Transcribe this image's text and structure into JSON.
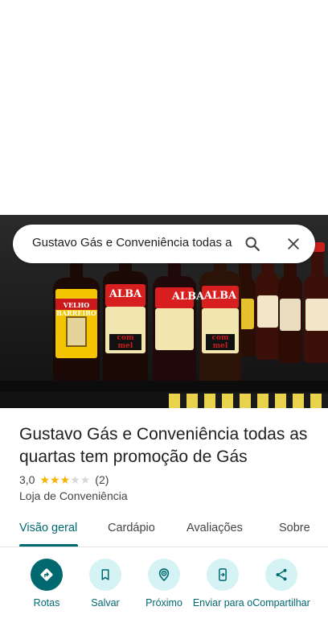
{
  "search": {
    "query": "Gustavo Gás e Conveniência todas a"
  },
  "place": {
    "name": "Gustavo Gás e Conveniência todas as quartas tem promoção de Gás",
    "rating": "3,0",
    "rating_value": 3,
    "review_count": "(2)",
    "category": "Loja de Conveniência"
  },
  "photo": {
    "labels": [
      "VELHO BARREIRO",
      "ALBA",
      "com mel",
      "ALBA",
      "com mel",
      "ALBA"
    ]
  },
  "tabs": [
    {
      "label": "Visão geral",
      "active": true
    },
    {
      "label": "Cardápio",
      "active": false
    },
    {
      "label": "Avaliações",
      "active": false
    },
    {
      "label": "Sobre",
      "active": false
    }
  ],
  "actions": [
    {
      "label": "Rotas",
      "icon": "directions-icon"
    },
    {
      "label": "Salvar",
      "icon": "bookmark-icon"
    },
    {
      "label": "Próximo",
      "icon": "nearby-icon"
    },
    {
      "label": "Enviar para o",
      "icon": "send-to-phone-icon"
    },
    {
      "label": "Compartilhar",
      "icon": "share-icon"
    }
  ],
  "colors": {
    "accent": "#00696f",
    "action_bg": "#d5f2f5",
    "star_filled": "#f5b400",
    "star_empty": "#d8d8d8"
  }
}
